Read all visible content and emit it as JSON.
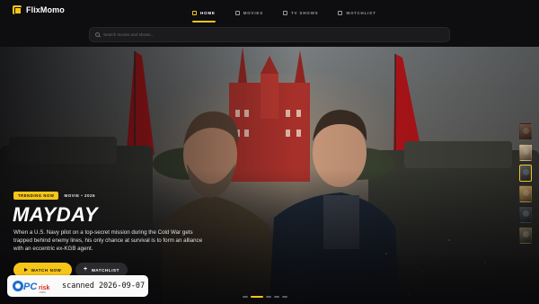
{
  "app": {
    "name": "FlixMomo",
    "accent": "#f5c518"
  },
  "nav": {
    "items": [
      {
        "label": "HOME",
        "icon": "home-icon",
        "active": true
      },
      {
        "label": "MOVIES",
        "icon": "film-icon",
        "active": false
      },
      {
        "label": "TV SHOWS",
        "icon": "tv-icon",
        "active": false
      },
      {
        "label": "WATCHLIST",
        "icon": "bookmark-icon",
        "active": false
      }
    ]
  },
  "search": {
    "placeholder": "Search movies and shows..."
  },
  "hero": {
    "badge": "TRENDING NOW",
    "meta": "MOVIE • 2026",
    "title": "MAYDAY",
    "description": "When a U.S. Navy pilot on a top-secret mission during the Cold War gets trapped behind enemy lines, his only chance at survival is to form an alliance with an eccentric ex-KGB agent.",
    "watch_label": "WATCH NOW",
    "watchlist_label": "WATCHLIST"
  },
  "thumbnails": {
    "count": 6,
    "active_index": 2
  },
  "pagination": {
    "count": 5,
    "active_index": 1
  },
  "watermark": {
    "brand": "PCrisk.com",
    "text": "scanned 2026-09-07"
  }
}
